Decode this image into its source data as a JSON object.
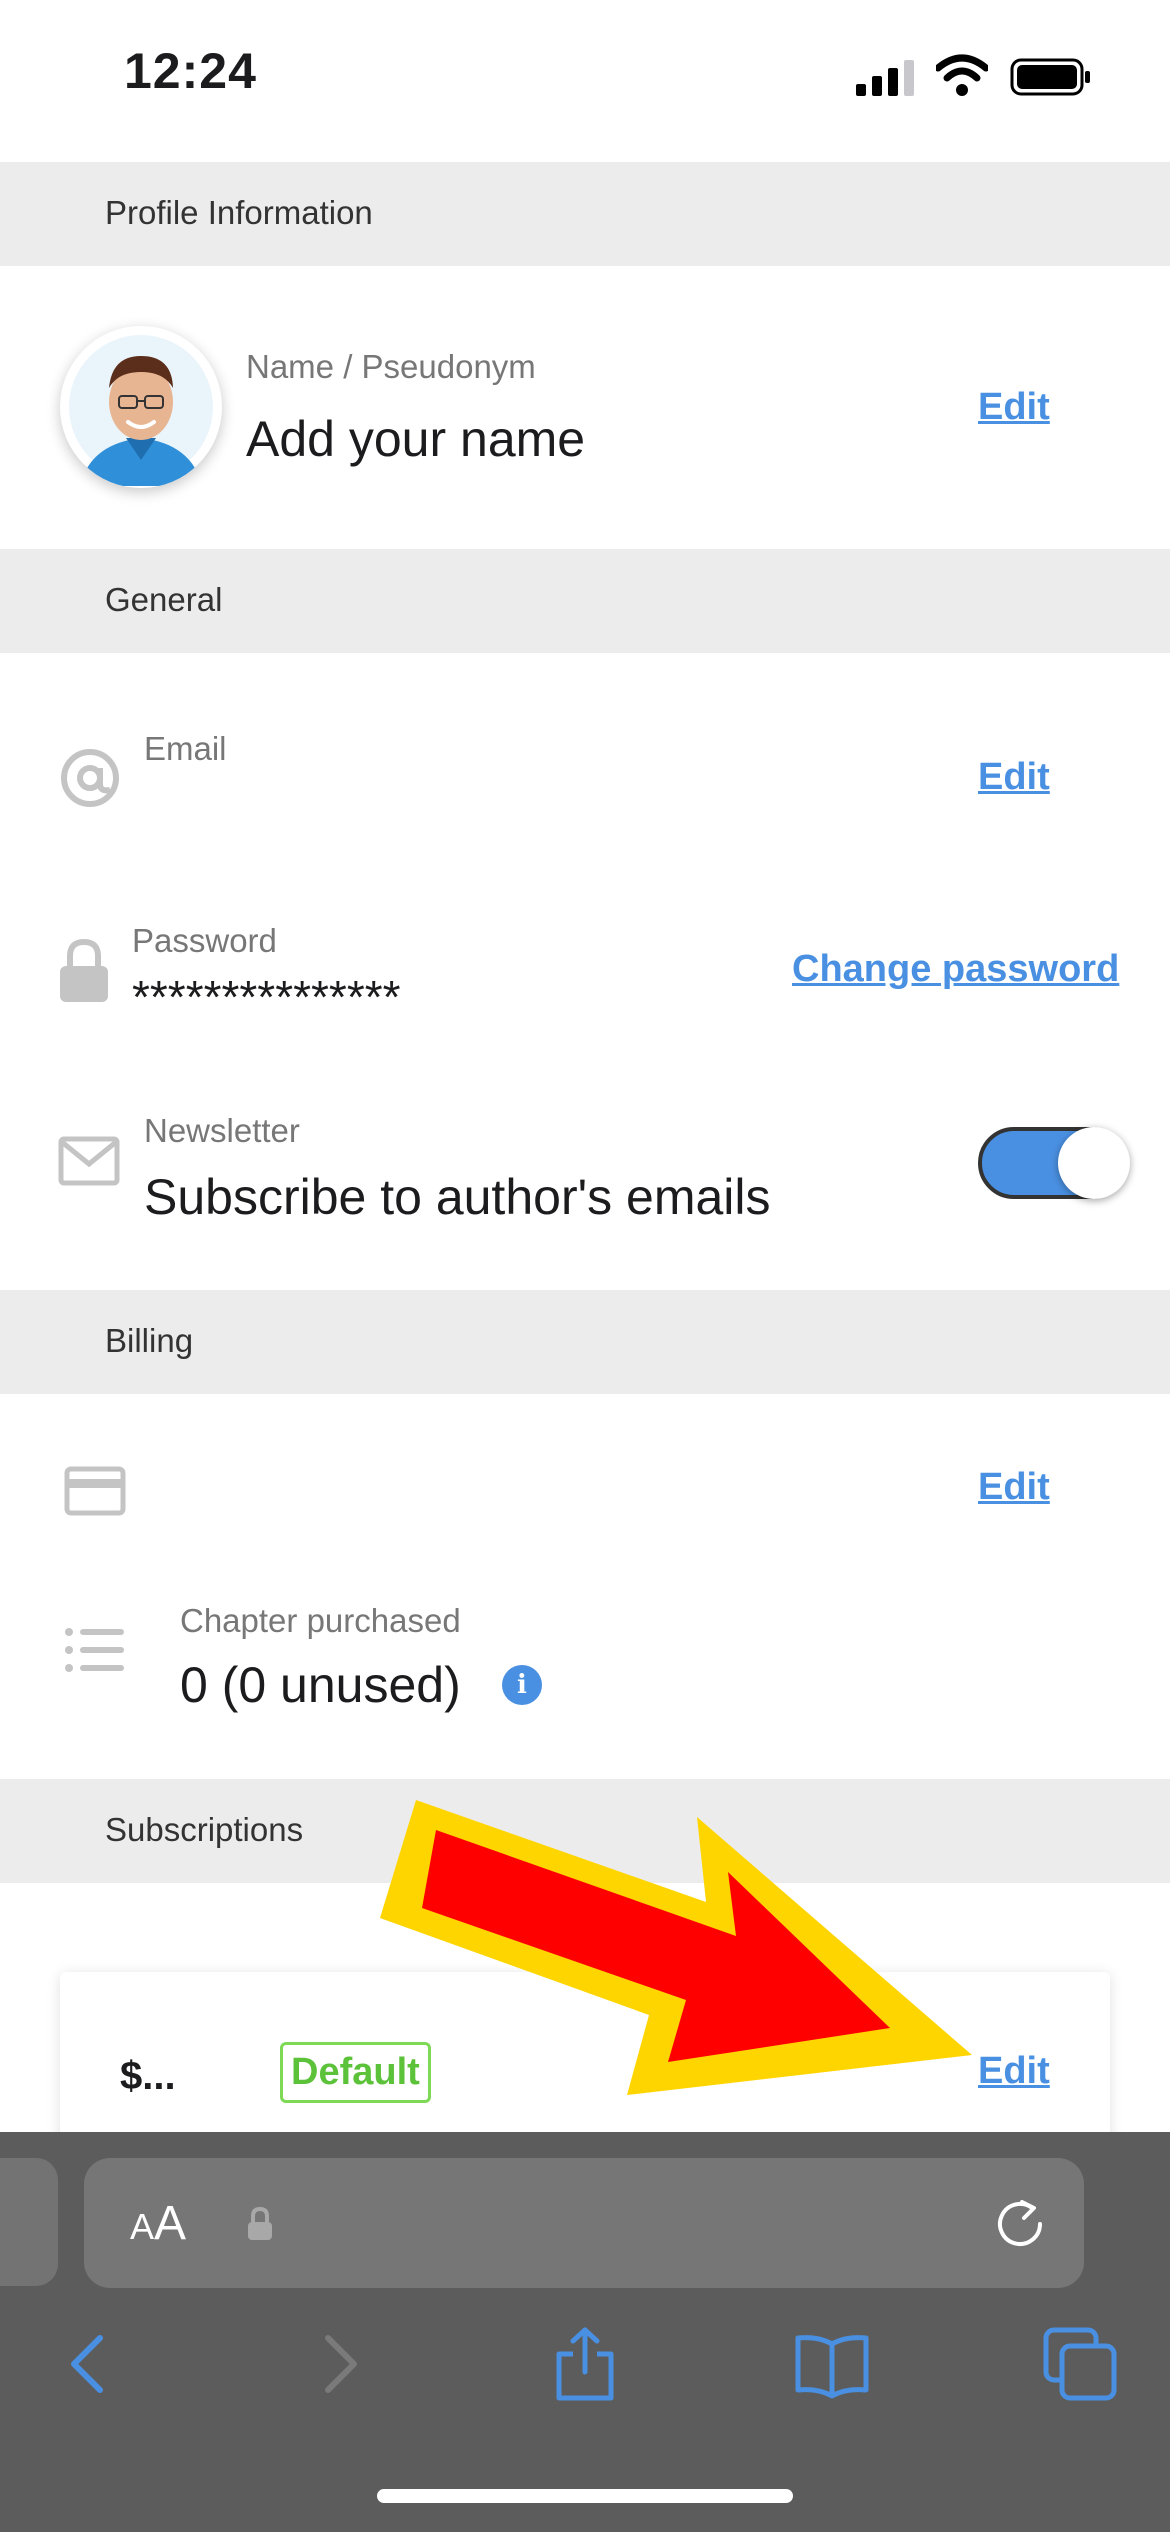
{
  "status_bar": {
    "time": "12:24"
  },
  "sections": {
    "profile": "Profile Information",
    "general": "General",
    "billing": "Billing",
    "subscriptions": "Subscriptions"
  },
  "profile": {
    "name_label": "Name / Pseudonym",
    "name_value": "Add your name",
    "edit_label": "Edit"
  },
  "general": {
    "email_label": "Email",
    "email_value": "",
    "email_edit": "Edit",
    "password_label": "Password",
    "password_value": "***************",
    "password_action": "Change password",
    "newsletter_label": "Newsletter",
    "newsletter_value": "Subscribe to author's emails",
    "newsletter_enabled": true
  },
  "billing": {
    "card_edit": "Edit",
    "chapters_label": "Chapter purchased",
    "chapters_value": "0 (0 unused)",
    "info_glyph": "i"
  },
  "subscriptions": {
    "items": [
      {
        "price": "$...",
        "badge": "Default",
        "edit_label": "Edit"
      }
    ]
  },
  "browser": {
    "aa_small": "A",
    "aa_large": "A",
    "icons": [
      "back-icon",
      "forward-icon",
      "share-icon",
      "bookmarks-icon",
      "tabs-icon",
      "lock-icon",
      "reload-icon"
    ]
  },
  "colors": {
    "accent": "#4a90e2",
    "section_bg": "#ececec",
    "badge_green": "#5cc23a",
    "arrow_red": "#ff0000",
    "arrow_yellow": "#ffd500",
    "toolbar_bg": "#5c5c5c"
  }
}
